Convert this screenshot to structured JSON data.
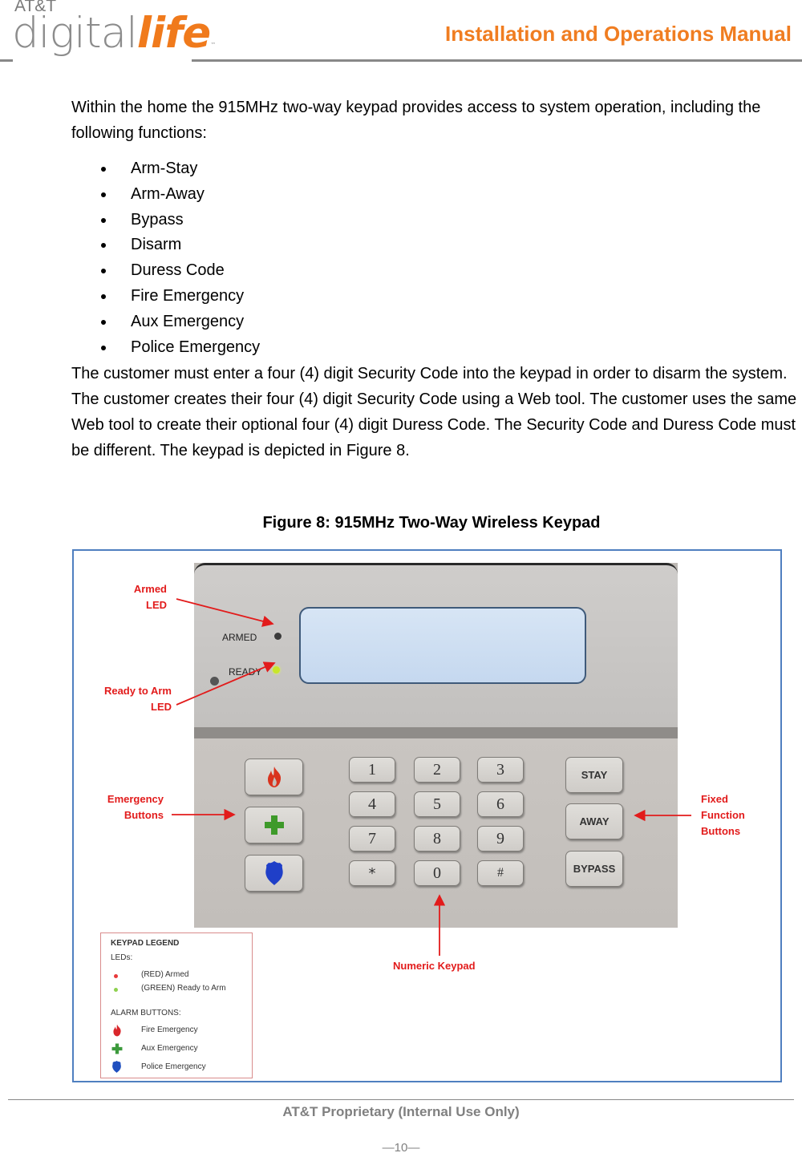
{
  "header": {
    "logo": {
      "brand_top": "AT&T",
      "brand_main": "digital",
      "brand_accent": "life",
      "trademark": "™"
    },
    "title": "Installation and Operations Manual"
  },
  "body": {
    "intro": "Within the home the 915MHz two-way keypad provides access to system operation, including the following functions:",
    "functions": [
      "Arm-Stay",
      "Arm-Away",
      "Bypass",
      "Disarm",
      "Duress Code",
      "Fire Emergency",
      "Aux Emergency",
      "Police Emergency"
    ],
    "security_paragraph": "The customer must enter a four (4) digit Security Code into the keypad in order to disarm the system. The customer creates their four (4) digit Security Code using a Web tool. The customer uses the same Web tool to create their optional four (4) digit Duress Code. The Security Code and Duress Code must be different. The keypad is depicted in Figure 8."
  },
  "figure": {
    "caption": "Figure 8:  915MHz Two-Way Wireless Keypad",
    "device": {
      "led_labels": {
        "armed": "ARMED",
        "ready": "READY"
      },
      "numeric_keys": [
        "1",
        "2",
        "3",
        "4",
        "5",
        "6",
        "7",
        "8",
        "9",
        "*",
        "0",
        "#"
      ],
      "function_keys": [
        "STAY",
        "AWAY",
        "BYPASS"
      ],
      "emergency_keys": [
        "fire",
        "aux",
        "police"
      ]
    },
    "annotations": {
      "armed_led": [
        "Armed",
        "LED"
      ],
      "ready_led": [
        "Ready to Arm",
        "LED"
      ],
      "emergency_buttons": [
        "Emergency",
        "Buttons"
      ],
      "fixed_function": [
        "Fixed",
        "Function",
        "Buttons"
      ],
      "numeric_keypad": "Numeric Keypad"
    },
    "legend": {
      "title": "KEYPAD LEGEND",
      "leds_heading": "LEDs:",
      "leds": [
        {
          "label": "(RED) Armed",
          "color": "#e8393b"
        },
        {
          "label": "(GREEN) Ready to Arm",
          "color": "#8fd14f"
        }
      ],
      "alarm_heading": "ALARM BUTTONS:",
      "alarms": [
        {
          "label": "Fire Emergency",
          "icon": "fire-icon",
          "color": "#d9262b"
        },
        {
          "label": "Aux Emergency",
          "icon": "medical-cross-icon",
          "color": "#3c9a3c"
        },
        {
          "label": "Police Emergency",
          "icon": "police-shield-icon",
          "color": "#1f4fbf"
        }
      ]
    },
    "colors": {
      "annotation_red": "#e21b1b",
      "frame_blue": "#4f7fc0"
    }
  },
  "footer": {
    "notice": "AT&T Proprietary (Internal Use Only)",
    "page_number": "—10—"
  }
}
